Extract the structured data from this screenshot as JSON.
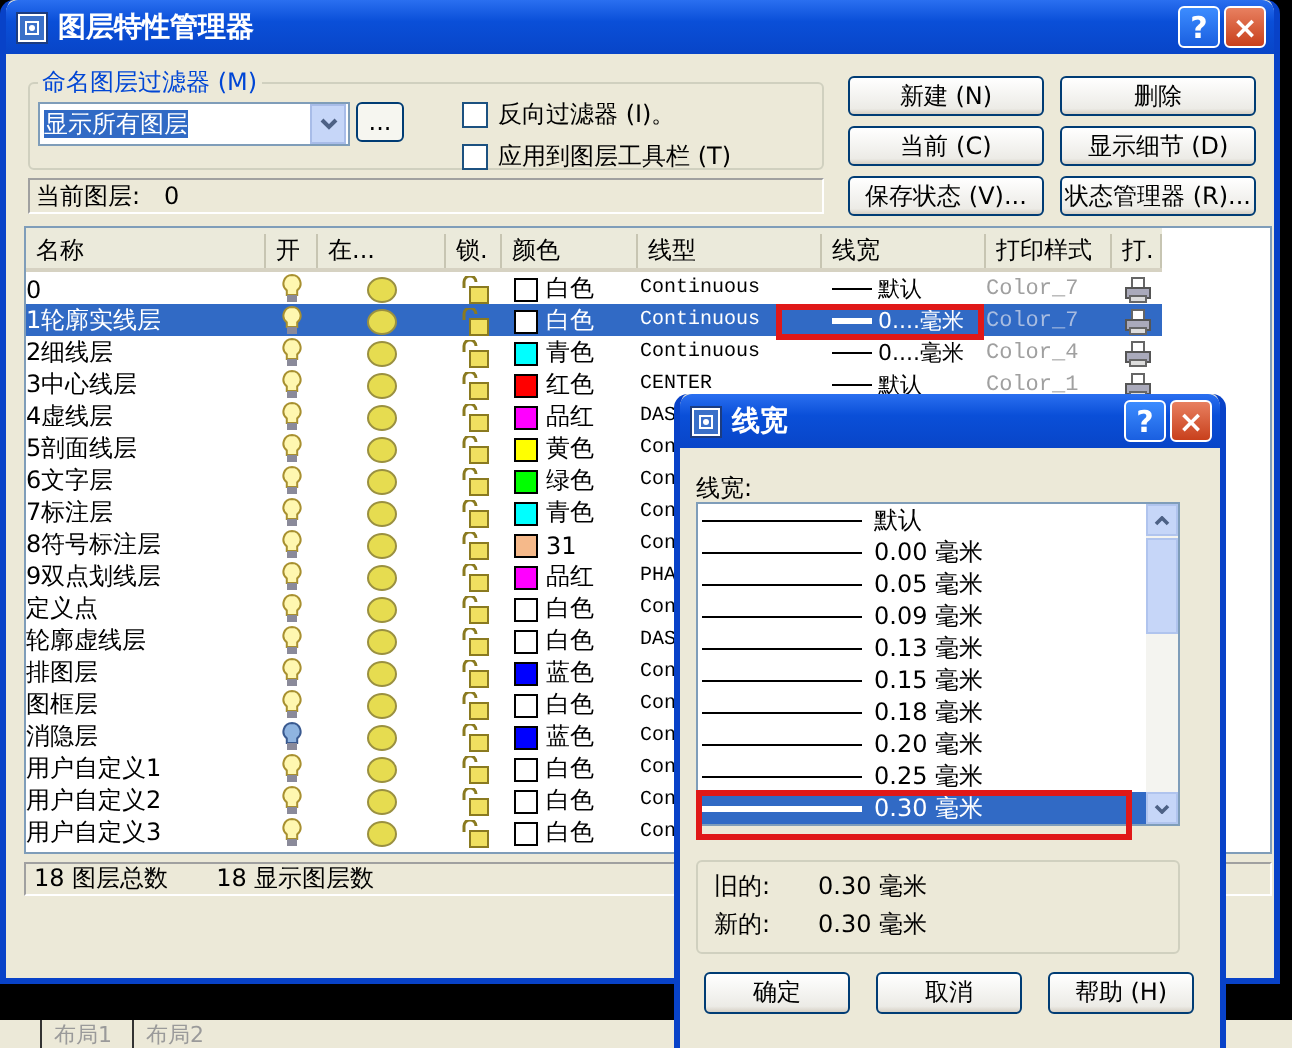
{
  "window": {
    "title": "图层特性管理器",
    "controls": [
      "?",
      "×"
    ]
  },
  "filter": {
    "label": "命名图层过滤器 (M)",
    "value": "显示所有图层",
    "browse": "..."
  },
  "options": [
    {
      "label": "反向过滤器 (I)。",
      "checked": false
    },
    {
      "label": "应用到图层工具栏 (T)",
      "checked": false
    }
  ],
  "buttons": [
    "新建 (N)",
    "删除",
    "当前 (C)",
    "显示细节 (D)",
    "保存状态 (V)...",
    "状态管理器 (R)..."
  ],
  "current_layer": {
    "label": "当前图层:",
    "value": "0"
  },
  "table": {
    "columns": [
      "名称",
      "开",
      "在...",
      "锁.",
      "颜色",
      "线型",
      "线宽",
      "打印样式",
      "打."
    ],
    "rows": [
      {
        "name": "0",
        "on": true,
        "color": "#ffffff",
        "color_name": "白色",
        "linetype": "Continuous",
        "lineweight": "默认",
        "plot_style": "Color_7",
        "selected": false
      },
      {
        "name": "1轮廓实线层",
        "on": true,
        "color": "#ffffff",
        "color_name": "白色",
        "linetype": "Continuous",
        "lineweight": "0....毫米",
        "plot_style": "Color_7",
        "selected": true
      },
      {
        "name": "2细线层",
        "on": true,
        "color": "#00ffff",
        "color_name": "青色",
        "linetype": "Continuous",
        "lineweight": "0....毫米",
        "plot_style": "Color_4",
        "selected": false
      },
      {
        "name": "3中心线层",
        "on": true,
        "color": "#ff0000",
        "color_name": "红色",
        "linetype": "CENTER",
        "lineweight": "默认",
        "plot_style": "Color_1",
        "selected": false
      },
      {
        "name": "4虚线层",
        "on": true,
        "color": "#ff00ff",
        "color_name": "品红",
        "linetype": "DAS",
        "selected": false
      },
      {
        "name": "5剖面线层",
        "on": true,
        "color": "#ffff00",
        "color_name": "黄色",
        "linetype": "Con",
        "selected": false
      },
      {
        "name": "6文字层",
        "on": true,
        "color": "#00ff00",
        "color_name": "绿色",
        "linetype": "Con",
        "selected": false
      },
      {
        "name": "7标注层",
        "on": true,
        "color": "#00ffff",
        "color_name": "青色",
        "linetype": "Con",
        "selected": false
      },
      {
        "name": "8符号标注层",
        "on": true,
        "color": "#f5b98a",
        "color_name": "31",
        "linetype": "Con",
        "selected": false
      },
      {
        "name": "9双点划线层",
        "on": true,
        "color": "#ff00ff",
        "color_name": "品红",
        "linetype": "PHA",
        "selected": false
      },
      {
        "name": "定义点",
        "on": true,
        "color": "#ffffff",
        "color_name": "白色",
        "linetype": "Con",
        "selected": false
      },
      {
        "name": "轮廓虚线层",
        "on": true,
        "color": "#ffffff",
        "color_name": "白色",
        "linetype": "DAS",
        "selected": false
      },
      {
        "name": "排图层",
        "on": true,
        "color": "#0000ff",
        "color_name": "蓝色",
        "linetype": "Con",
        "selected": false
      },
      {
        "name": "图框层",
        "on": true,
        "color": "#ffffff",
        "color_name": "白色",
        "linetype": "Con",
        "selected": false
      },
      {
        "name": "消隐层",
        "on": false,
        "color": "#0000ff",
        "color_name": "蓝色",
        "linetype": "Con",
        "selected": false
      },
      {
        "name": "用户自定义1",
        "on": true,
        "color": "#ffffff",
        "color_name": "白色",
        "linetype": "Con",
        "selected": false
      },
      {
        "name": "用户自定义2",
        "on": true,
        "color": "#ffffff",
        "color_name": "白色",
        "linetype": "Con",
        "selected": false
      },
      {
        "name": "用户自定义3",
        "on": true,
        "color": "#ffffff",
        "color_name": "白色",
        "linetype": "Con",
        "selected": false
      }
    ]
  },
  "status": [
    "18 图层总数",
    "18 显示图层数"
  ],
  "layout_tabs": [
    "布局1",
    "布局2"
  ],
  "lineweight_dialog": {
    "title": "线宽",
    "controls": [
      "?",
      "×"
    ],
    "label": "线宽:",
    "items": [
      {
        "label": "默认",
        "selected": false
      },
      {
        "label": "0.00 毫米",
        "selected": false
      },
      {
        "label": "0.05 毫米",
        "selected": false
      },
      {
        "label": "0.09 毫米",
        "selected": false
      },
      {
        "label": "0.13 毫米",
        "selected": false
      },
      {
        "label": "0.15 毫米",
        "selected": false
      },
      {
        "label": "0.18 毫米",
        "selected": false
      },
      {
        "label": "0.20 毫米",
        "selected": false
      },
      {
        "label": "0.25 毫米",
        "selected": false
      },
      {
        "label": "0.30 毫米",
        "selected": true
      }
    ],
    "old": {
      "label": "旧的:",
      "value": "0.30 毫米"
    },
    "new": {
      "label": "新的:",
      "value": "0.30 毫米"
    },
    "buttons": [
      "确定",
      "取消",
      "帮助 (H)"
    ]
  }
}
